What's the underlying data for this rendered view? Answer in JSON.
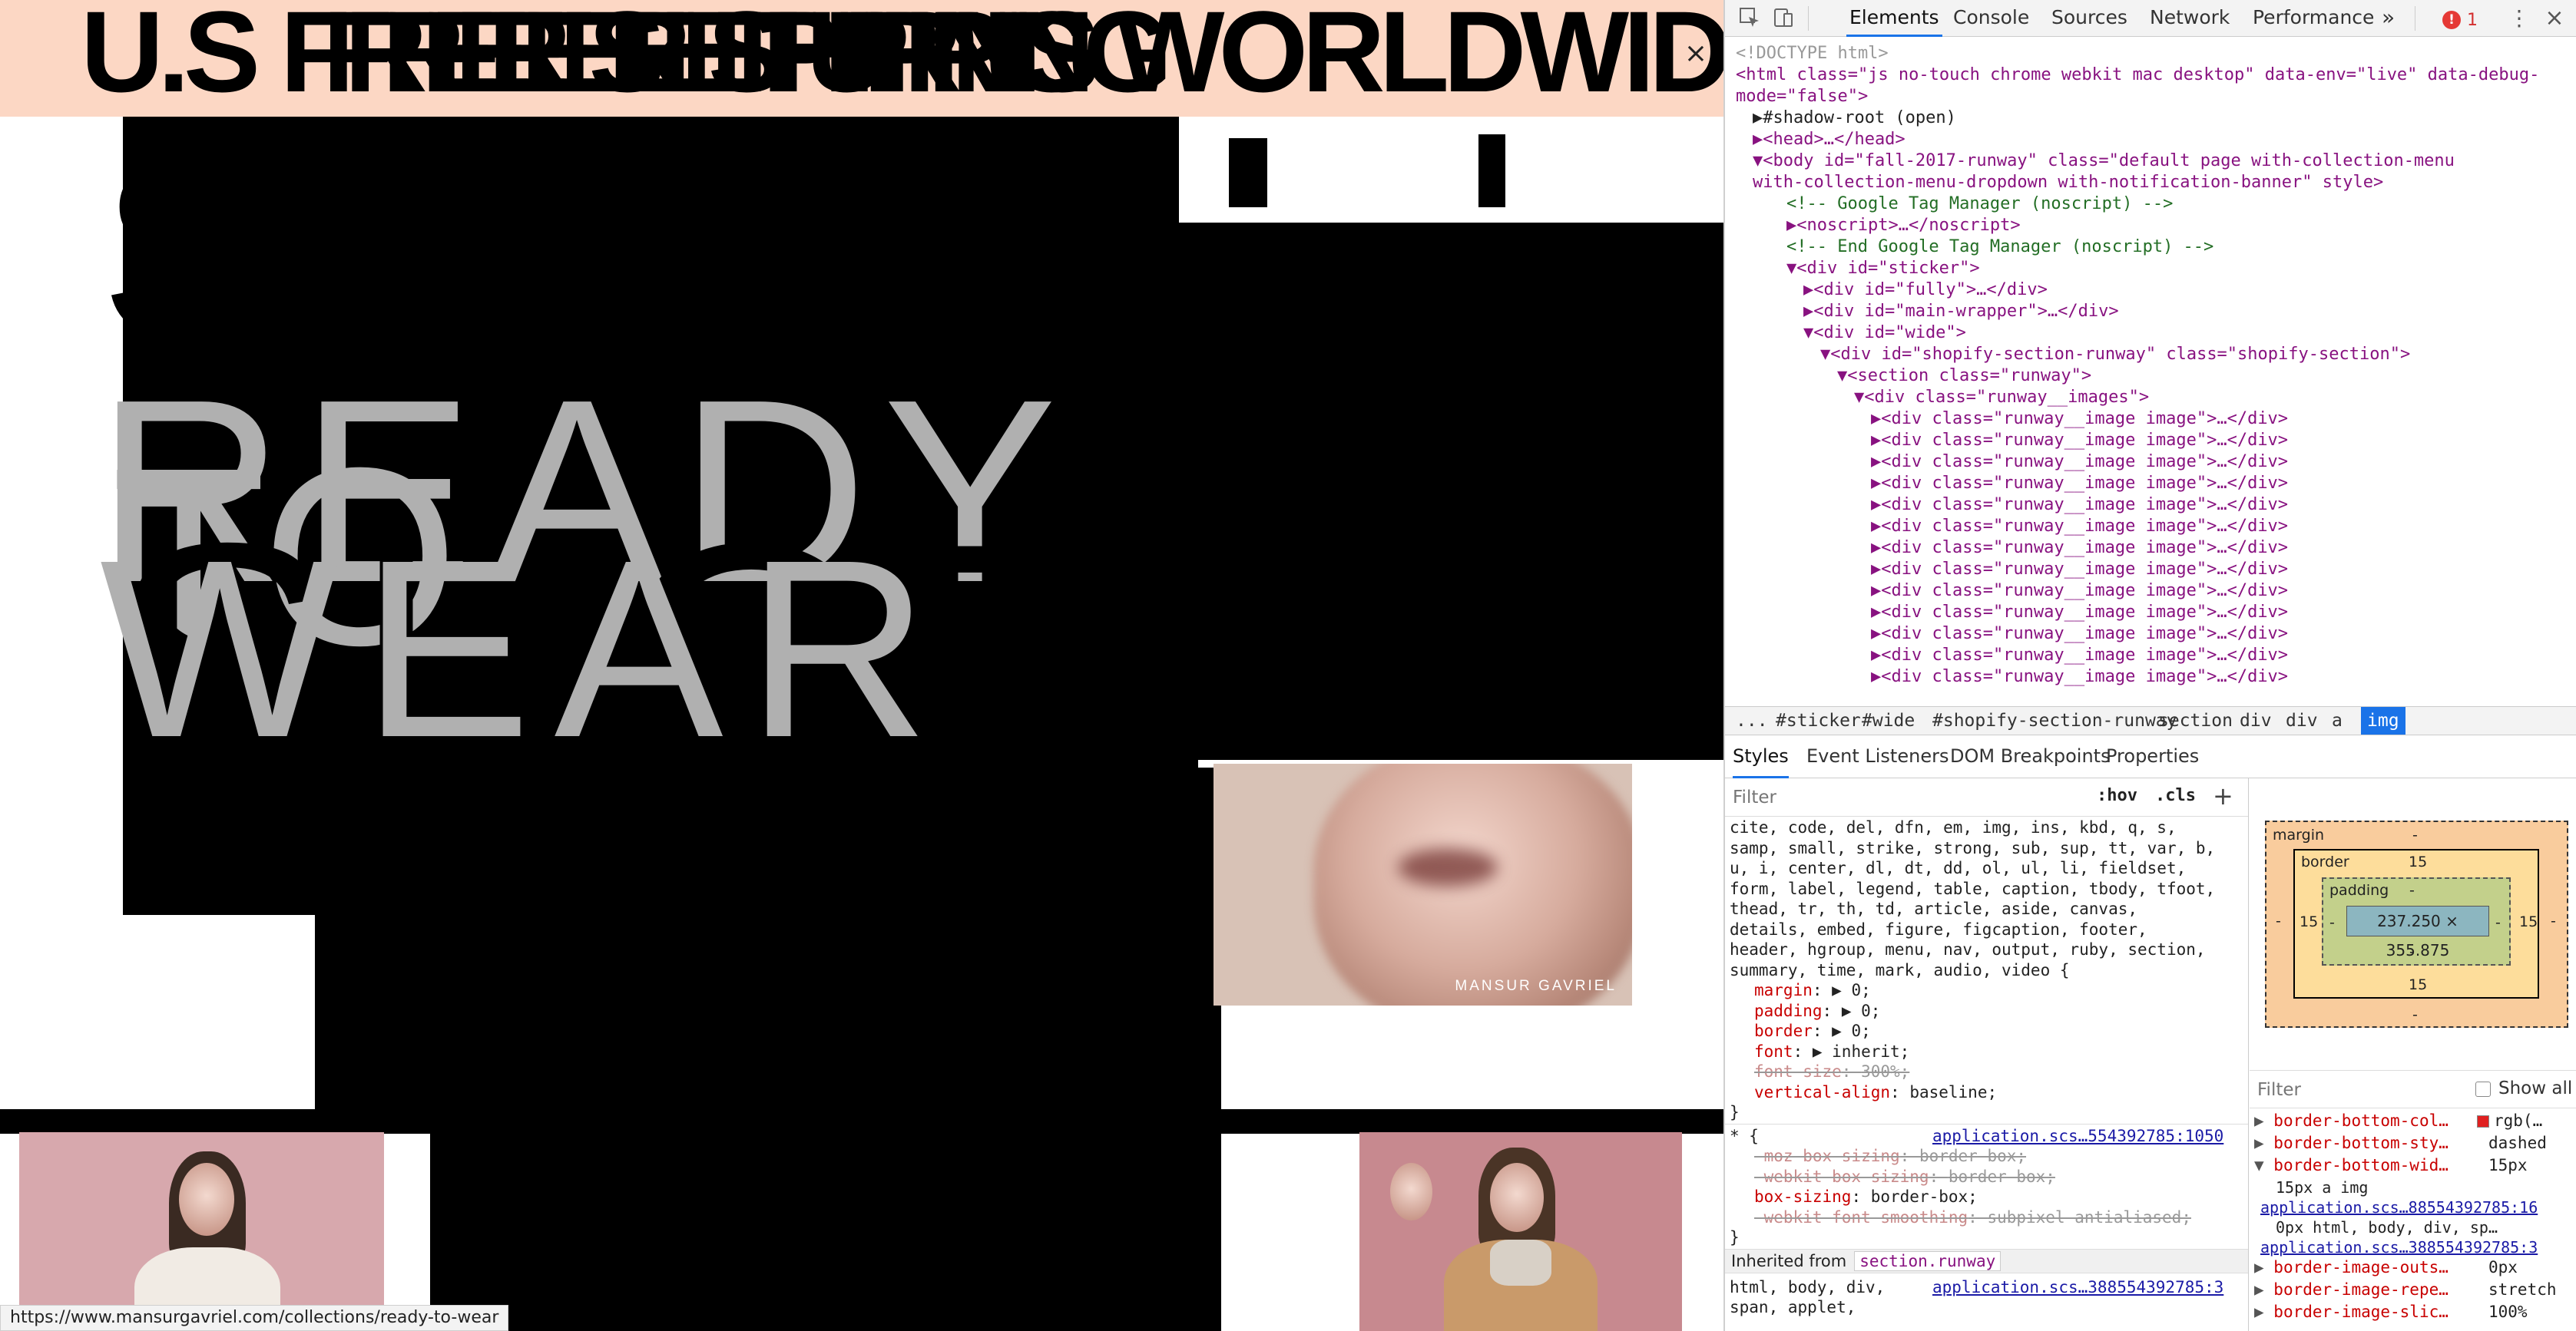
{
  "banner": {
    "text": "U.S FREE SHIPPING WORLDWIDE AND",
    "text_2": "FREE RETURNS",
    "text_3": "FREE SHIPPING",
    "close_label": "×"
  },
  "hero": {
    "word_ready": "READY",
    "word_to": "TO",
    "word_wear": "WEAR",
    "word_shop": "SHOP",
    "word_sale": "SALE"
  },
  "video": {
    "brand_label": "MANSUR GAVRIEL"
  },
  "status_bar": {
    "url": "https://www.mansurgavriel.com/collections/ready-to-wear"
  },
  "devtools": {
    "tabs": [
      "Elements",
      "Console",
      "Sources",
      "Network",
      "Performance"
    ],
    "more_tabs": "»",
    "error_count": "1",
    "dom_lines": [
      {
        "indent": 0,
        "text": "<!DOCTYPE html>",
        "kind": "doc"
      },
      {
        "indent": 0,
        "text": "<html class=\"js no-touch chrome webkit mac desktop\" data-env=\"live\" data-debug-",
        "kind": "tag"
      },
      {
        "indent": 0,
        "text": "mode=\"false\">",
        "kind": "tag"
      },
      {
        "indent": 1,
        "text": "▶#shadow-root (open)",
        "kind": "plain"
      },
      {
        "indent": 1,
        "text": "▶<head>…</head>",
        "kind": "tag"
      },
      {
        "indent": 1,
        "text": "▼<body id=\"fall-2017-runway\" class=\"default   page     with-collection-menu",
        "kind": "tag"
      },
      {
        "indent": 1,
        "text": "with-collection-menu-dropdown with-notification-banner\" style>",
        "kind": "tag"
      },
      {
        "indent": 3,
        "text": "<!-- Google Tag Manager (noscript) -->",
        "kind": "cmt"
      },
      {
        "indent": 3,
        "text": "▶<noscript>…</noscript>",
        "kind": "tag"
      },
      {
        "indent": 3,
        "text": "<!-- End Google Tag Manager (noscript) -->",
        "kind": "cmt"
      },
      {
        "indent": 3,
        "text": "▼<div id=\"sticker\">",
        "kind": "tag"
      },
      {
        "indent": 4,
        "text": "▶<div id=\"fully\">…</div>",
        "kind": "tag"
      },
      {
        "indent": 4,
        "text": "▶<div id=\"main-wrapper\">…</div>",
        "kind": "tag"
      },
      {
        "indent": 4,
        "text": "▼<div id=\"wide\">",
        "kind": "tag"
      },
      {
        "indent": 5,
        "text": "▼<div id=\"shopify-section-runway\" class=\"shopify-section\">",
        "kind": "tag"
      },
      {
        "indent": 6,
        "text": "▼<section class=\"runway\">",
        "kind": "tag"
      },
      {
        "indent": 7,
        "text": "▼<div class=\"runway__images\">",
        "kind": "tag"
      },
      {
        "indent": 8,
        "text": "▶<div class=\"runway__image image\">…</div>",
        "kind": "tag"
      },
      {
        "indent": 8,
        "text": "▶<div class=\"runway__image image\">…</div>",
        "kind": "tag"
      },
      {
        "indent": 8,
        "text": "▶<div class=\"runway__image image\">…</div>",
        "kind": "tag"
      },
      {
        "indent": 8,
        "text": "▶<div class=\"runway__image image\">…</div>",
        "kind": "tag"
      },
      {
        "indent": 8,
        "text": "▶<div class=\"runway__image image\">…</div>",
        "kind": "tag"
      },
      {
        "indent": 8,
        "text": "▶<div class=\"runway__image image\">…</div>",
        "kind": "tag"
      },
      {
        "indent": 8,
        "text": "▶<div class=\"runway__image image\">…</div>",
        "kind": "tag"
      },
      {
        "indent": 8,
        "text": "▶<div class=\"runway__image image\">…</div>",
        "kind": "tag"
      },
      {
        "indent": 8,
        "text": "▶<div class=\"runway__image image\">…</div>",
        "kind": "tag"
      },
      {
        "indent": 8,
        "text": "▶<div class=\"runway__image image\">…</div>",
        "kind": "tag"
      },
      {
        "indent": 8,
        "text": "▶<div class=\"runway__image image\">…</div>",
        "kind": "tag"
      },
      {
        "indent": 8,
        "text": "▶<div class=\"runway__image image\">…</div>",
        "kind": "tag"
      },
      {
        "indent": 8,
        "text": "▶<div class=\"runway__image image\">…</div>",
        "kind": "tag"
      }
    ],
    "breadcrumbs": [
      "...",
      "#sticker",
      "#wide",
      "#shopify-section-runway",
      "section",
      "div",
      "div",
      "a",
      "img"
    ],
    "styles_tabs": [
      "Styles",
      "Event Listeners",
      "DOM Breakpoints",
      "Properties"
    ],
    "styles_filter_placeholder": "Filter",
    "styles_hov": ":hov",
    "styles_cls": ".cls",
    "styles_add": "+",
    "selector_lines": [
      "cite, code, del, dfn, em, img, ins, kbd, q, s,",
      "samp, small, strike, strong, sub, sup, tt, var, b,",
      "u, i, center, dl, dt, dd, ol, ul, li, fieldset,",
      "form, label, legend, table, caption, tbody, tfoot,",
      "thead, tr, th, td, article, aside, canvas,",
      "details, embed, figure, figcaption, footer,",
      "header, hgroup, menu, nav, output, ruby, section,",
      "summary, time, mark, audio, video {"
    ],
    "rule1_props": [
      {
        "name": "margin",
        "value": "▶ 0;",
        "struck": false
      },
      {
        "name": "padding",
        "value": "▶ 0;",
        "struck": false
      },
      {
        "name": "border",
        "value": "▶ 0;",
        "struck": false
      },
      {
        "name": "font",
        "value": "▶ inherit;",
        "struck": false
      },
      {
        "name": "font-size",
        "value": "300%;",
        "struck": true
      },
      {
        "name": "vertical-align",
        "value": "baseline;",
        "struck": false
      }
    ],
    "rule1_close": "}",
    "rule2_selector": "* {",
    "rule2_source": "application.scs…554392785:1050",
    "rule2_props": [
      {
        "name": "-moz-box-sizing",
        "value": "border-box;",
        "struck": true
      },
      {
        "name": "-webkit-box-sizing",
        "value": "border-box;",
        "struck": true
      },
      {
        "name": "box-sizing",
        "value": "border-box;",
        "struck": false
      },
      {
        "name": "-webkit-font-smoothing",
        "value": "subpixel-antialiased;",
        "struck": true
      }
    ],
    "rule2_close": "}",
    "inherited_label": "Inherited from",
    "inherited_from": "section.runway",
    "rule3_selector": "html, body, div,",
    "rule3_selector_2": "span, applet,",
    "rule3_source": "application.scs…388554392785:3",
    "boxmodel": {
      "margin_label": "margin",
      "margin_value": "-",
      "border_label": "border",
      "border_top": "15",
      "border_left": "15",
      "border_right": "15",
      "border_bottom": "15",
      "padding_label": "padding",
      "padding_value": "-",
      "content": "237.250 × 355.875",
      "side_dash": "-",
      "bottom_dash": "-"
    },
    "computed_filter_placeholder": "Filter",
    "show_all_label": "Show all",
    "computed_props": [
      {
        "name": "border-bottom-col…",
        "value": "rgb(…",
        "swatch": "#e02020",
        "expanded": false
      },
      {
        "name": "border-bottom-sty…",
        "value": "dashed",
        "expanded": false
      },
      {
        "name": "border-bottom-wid…",
        "value": "15px",
        "expanded": true
      },
      {
        "name": "border-image-outs…",
        "value": "0px",
        "expanded": false
      },
      {
        "name": "border-image-repe…",
        "value": "stretch",
        "expanded": false
      },
      {
        "name": "border-image-slic…",
        "value": "100%",
        "expanded": false
      }
    ],
    "computed_detail_1": "15px    a img",
    "computed_detail_1_src": "application.scs…88554392785:16",
    "computed_detail_2": "0px    html, body, div, sp…",
    "computed_detail_2_src": "application.scs…388554392785:3"
  }
}
